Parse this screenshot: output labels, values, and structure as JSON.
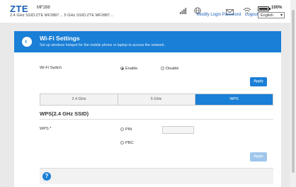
{
  "header": {
    "logo": "ZTE",
    "model": "MF288",
    "ssid_line": "2.4 GHz SSID:ZTE MF2887… 5 GHz SSID:ZTE MF2887…",
    "battery_text": "100%",
    "battery_level": 1.0,
    "links": [
      "Modify Login Password",
      "Logout"
    ],
    "language": "English"
  },
  "page": {
    "title": "Wi-Fi Settings",
    "subtitle": "Set up wireless hotspot for the mobile phone or laptop to access the network."
  },
  "wifi_switch": {
    "label": "Wi-Fi Switch",
    "options": [
      "Enable",
      "Disable"
    ],
    "selected": "Enable",
    "apply": "Apply"
  },
  "tabs": [
    {
      "label": "2.4 GHz",
      "active": false
    },
    {
      "label": "5 GHz",
      "active": false
    },
    {
      "label": "WPS",
      "active": true
    }
  ],
  "wps": {
    "section_title": "WPS(2.4 GHz SSID)",
    "label": "WPS *",
    "options": [
      "PIN",
      "PBC"
    ],
    "pin_value": "",
    "apply": "Apply"
  },
  "icons": {
    "back": "back-arrow-icon",
    "help": "help-icon",
    "signal": "signal-bars-icon",
    "globe": "globe-icon",
    "sms": "sms-icon",
    "wifi": "wifi-icon"
  },
  "colors": {
    "accent": "#1a7fd6",
    "logo": "#1a5fb4"
  }
}
